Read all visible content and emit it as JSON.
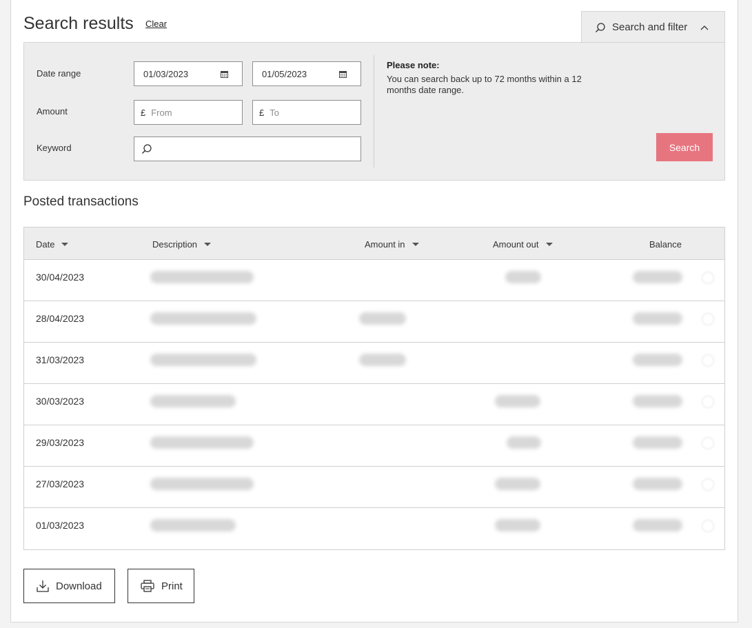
{
  "header": {
    "title": "Search results",
    "clear_label": "Clear"
  },
  "search_filter": {
    "label": "Search and filter",
    "date_range_label": "Date range",
    "date_from": "01/03/2023",
    "date_to": "01/05/2023",
    "amount_label": "Amount",
    "currency_symbol": "£",
    "amount_from_placeholder": "From",
    "amount_to_placeholder": "To",
    "keyword_label": "Keyword",
    "note_title": "Please note:",
    "note_text": "You can search back up to 72 months within a 12 months date range.",
    "search_button": "Search",
    "search_button_color": "#e77580"
  },
  "transactions": {
    "section_title": "Posted transactions",
    "columns": [
      "Date",
      "Description",
      "Amount in",
      "Amount out",
      "Balance"
    ],
    "rows": [
      {
        "date": "30/04/2023",
        "has_amount_in": false,
        "has_amount_out": true
      },
      {
        "date": "28/04/2023",
        "has_amount_in": true,
        "has_amount_out": false
      },
      {
        "date": "31/03/2023",
        "has_amount_in": true,
        "has_amount_out": false
      },
      {
        "date": "30/03/2023",
        "has_amount_in": false,
        "has_amount_out": true
      },
      {
        "date": "29/03/2023",
        "has_amount_in": false,
        "has_amount_out": true
      },
      {
        "date": "27/03/2023",
        "has_amount_in": false,
        "has_amount_out": true
      },
      {
        "date": "01/03/2023",
        "has_amount_in": false,
        "has_amount_out": true
      }
    ]
  },
  "actions": {
    "download_label": "Download",
    "print_label": "Print"
  },
  "icons": {
    "search": "magnifier-icon",
    "chevron": "chevron-up-icon",
    "calendar": "calendar-icon",
    "download": "download-icon",
    "print": "printer-icon"
  }
}
